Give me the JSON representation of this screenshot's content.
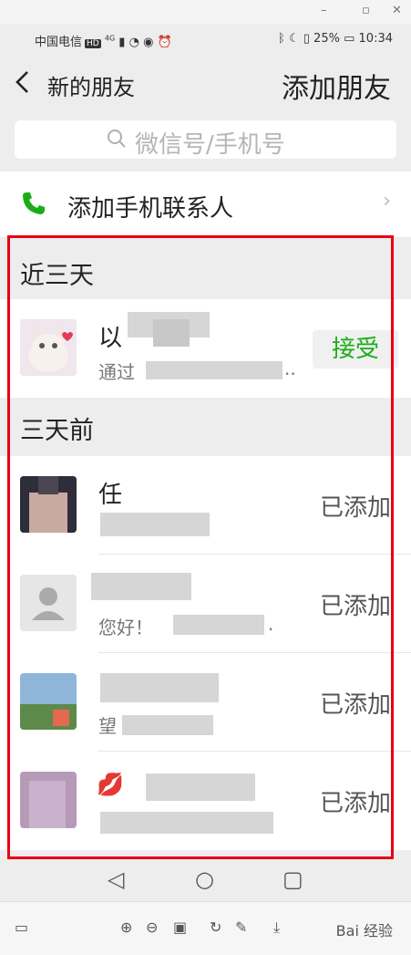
{
  "window": {
    "min": "–",
    "max": "▫",
    "close": "✕"
  },
  "status_bar": {
    "carrier": "中国电信",
    "hd": "HD",
    "net": "4G",
    "battery": "25%",
    "time": "10:34"
  },
  "nav": {
    "back_icon": "chevron-left",
    "title": "新的朋友",
    "action": "添加朋友"
  },
  "search": {
    "placeholder": "微信号/手机号"
  },
  "phone_contacts": {
    "label": "添加手机联系人"
  },
  "sections": [
    {
      "title": "近三天",
      "items": [
        {
          "name": "以",
          "message": "通过",
          "trail": "..",
          "action": "接受",
          "accent": "#1aad19"
        }
      ]
    },
    {
      "title": "三天前",
      "items": [
        {
          "name": "任",
          "message": "",
          "action": "已添加"
        },
        {
          "name": "",
          "message": "您好！",
          "trail": ".",
          "action": "已添加"
        },
        {
          "name": "",
          "message": "望",
          "action": "已添加"
        },
        {
          "name": "",
          "message": "",
          "action": "已添加"
        }
      ]
    }
  ],
  "highlight_color": "#e60012",
  "toolbar": {
    "watermark": "Bai 经验"
  }
}
